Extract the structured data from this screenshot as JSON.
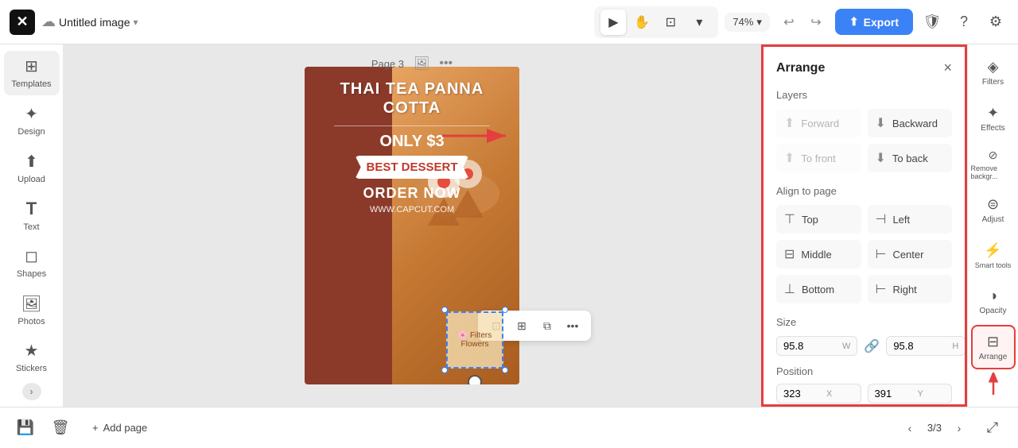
{
  "topbar": {
    "logo": "✕",
    "doc_title": "Untitled image",
    "title_chevron": "▾",
    "tools": {
      "select": "▶",
      "hand": "✋",
      "frame": "⊡",
      "zoom_level": "74%"
    },
    "undo": "↩",
    "redo": "↪",
    "export_label": "Export",
    "shield_icon": "🛡",
    "help_icon": "?",
    "settings_icon": "⚙"
  },
  "sidebar": {
    "items": [
      {
        "id": "templates",
        "icon": "⊞",
        "label": "Templates"
      },
      {
        "id": "design",
        "icon": "✦",
        "label": "Design"
      },
      {
        "id": "upload",
        "icon": "⬆",
        "label": "Upload"
      },
      {
        "id": "text",
        "icon": "T",
        "label": "Text"
      },
      {
        "id": "shapes",
        "icon": "◻",
        "label": "Shapes"
      },
      {
        "id": "photos",
        "icon": "🖼",
        "label": "Photos"
      },
      {
        "id": "stickers",
        "icon": "★",
        "label": "Stickers"
      }
    ],
    "collapse_icon": "›"
  },
  "canvas": {
    "page_label": "Page 3",
    "poster": {
      "title": "THAI TEA PANNA COTTA",
      "price_line": "ONLY $3",
      "badge": "BEST DESSERT",
      "order": "ORDER NOW",
      "website": "WWW.CAPCUT.COM"
    }
  },
  "floating_toolbar": {
    "crop_icon": "⊡",
    "grid_icon": "⊞",
    "copy_icon": "⧉",
    "more_icon": "•••"
  },
  "arrange_panel": {
    "title": "Arrange",
    "close_icon": "×",
    "layers_section": "Layers",
    "forward_label": "Forward",
    "backward_label": "Backward",
    "to_front_label": "To front",
    "to_back_label": "To back",
    "align_section": "Align to page",
    "top_label": "Top",
    "left_label": "Left",
    "middle_label": "Middle",
    "center_label": "Center",
    "bottom_label": "Bottom",
    "right_label": "Right",
    "size_section": "Size",
    "width_value": "95.8",
    "height_value": "95.8",
    "w_label": "W",
    "h_label": "H",
    "position_section": "Position",
    "x_value": "323",
    "y_value": "391",
    "x_label": "X",
    "y_label": "Y"
  },
  "far_right_sidebar": {
    "items": [
      {
        "id": "filters",
        "icon": "◈",
        "label": "Filters"
      },
      {
        "id": "effects",
        "icon": "✦",
        "label": "Effects"
      },
      {
        "id": "remove-bg",
        "icon": "⊘",
        "label": "Remove backgr..."
      },
      {
        "id": "adjust",
        "icon": "⊜",
        "label": "Adjust"
      },
      {
        "id": "smart-tools",
        "icon": "⚡",
        "label": "Smart tools"
      },
      {
        "id": "opacity",
        "icon": "◑",
        "label": "Opacity"
      },
      {
        "id": "arrange",
        "icon": "⊟",
        "label": "Arrange"
      }
    ]
  },
  "bottom_bar": {
    "save_icon": "💾",
    "delete_icon": "🗑",
    "add_page_label": "Add page",
    "page_back_icon": "‹",
    "page_counter": "3/3",
    "page_forward_icon": "›",
    "expand_icon": "⤢"
  }
}
